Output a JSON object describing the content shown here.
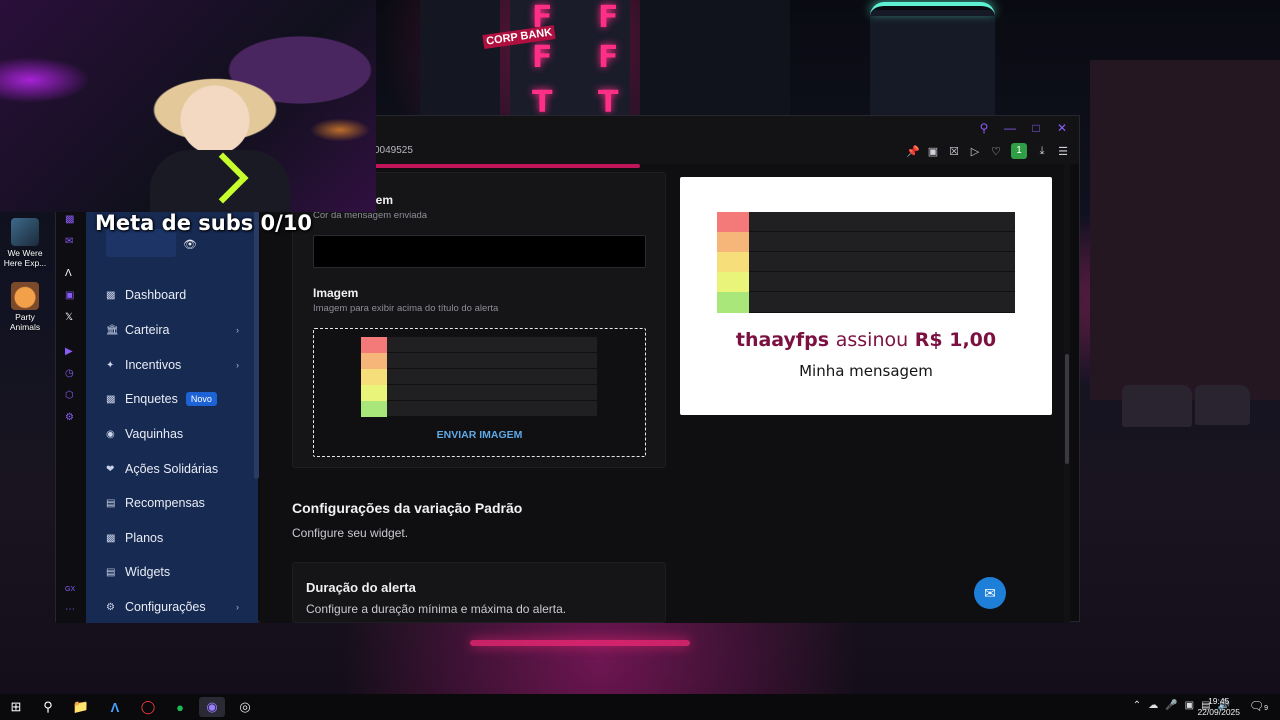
{
  "overlay": {
    "sub_goal": "Meta de subs 0/10"
  },
  "desktop": {
    "icons": [
      {
        "label": "We Were Here Exp..."
      },
      {
        "label": "Party Animals"
      }
    ],
    "city_sign": "CORP BANK"
  },
  "browser": {
    "url_fragment": "0049525",
    "extension_badge": "1"
  },
  "sidebar": {
    "items": [
      {
        "label": "Dashboard",
        "icon": "dashboard-icon",
        "has_submenu": false
      },
      {
        "label": "Carteira",
        "icon": "wallet-icon",
        "has_submenu": true
      },
      {
        "label": "Incentivos",
        "icon": "sparkle-icon",
        "has_submenu": true
      },
      {
        "label": "Enquetes",
        "icon": "poll-icon",
        "has_submenu": false,
        "badge": "Novo"
      },
      {
        "label": "Vaquinhas",
        "icon": "piggy-bank-icon",
        "has_submenu": false
      },
      {
        "label": "Ações Solidárias",
        "icon": "solidarity-icon",
        "has_submenu": false
      },
      {
        "label": "Recompensas",
        "icon": "gift-icon",
        "has_submenu": false
      },
      {
        "label": "Planos",
        "icon": "plans-icon",
        "has_submenu": false
      },
      {
        "label": "Widgets",
        "icon": "widgets-icon",
        "has_submenu": false
      },
      {
        "label": "Configurações",
        "icon": "settings-icon",
        "has_submenu": true
      }
    ]
  },
  "form": {
    "message_color": {
      "title": "sagem",
      "subtitle": "Cor da mensagem enviada",
      "value": "#000000"
    },
    "image": {
      "title": "Imagem",
      "subtitle": "Imagem para exibir acima do título do alerta",
      "upload_label": "ENVIAR IMAGEM"
    }
  },
  "preview": {
    "title_user": "thaayfps",
    "title_action": "assinou",
    "title_amount": "R$ 1,00",
    "message": "Minha mensagem",
    "accent": "#7b1141"
  },
  "variation": {
    "title": "Configurações da variação Padrão",
    "subtitle": "Configure seu widget."
  },
  "duration": {
    "title": "Duração do alerta",
    "subtitle": "Configure a duração mínima e máxima do alerta."
  },
  "tier_colors": [
    "#f47a7a",
    "#f6b67a",
    "#f6df7a",
    "#e9f57a",
    "#a9e77a"
  ],
  "taskbar": {
    "time": "19:45",
    "date": "22/09/2025",
    "notification_count": "9"
  }
}
